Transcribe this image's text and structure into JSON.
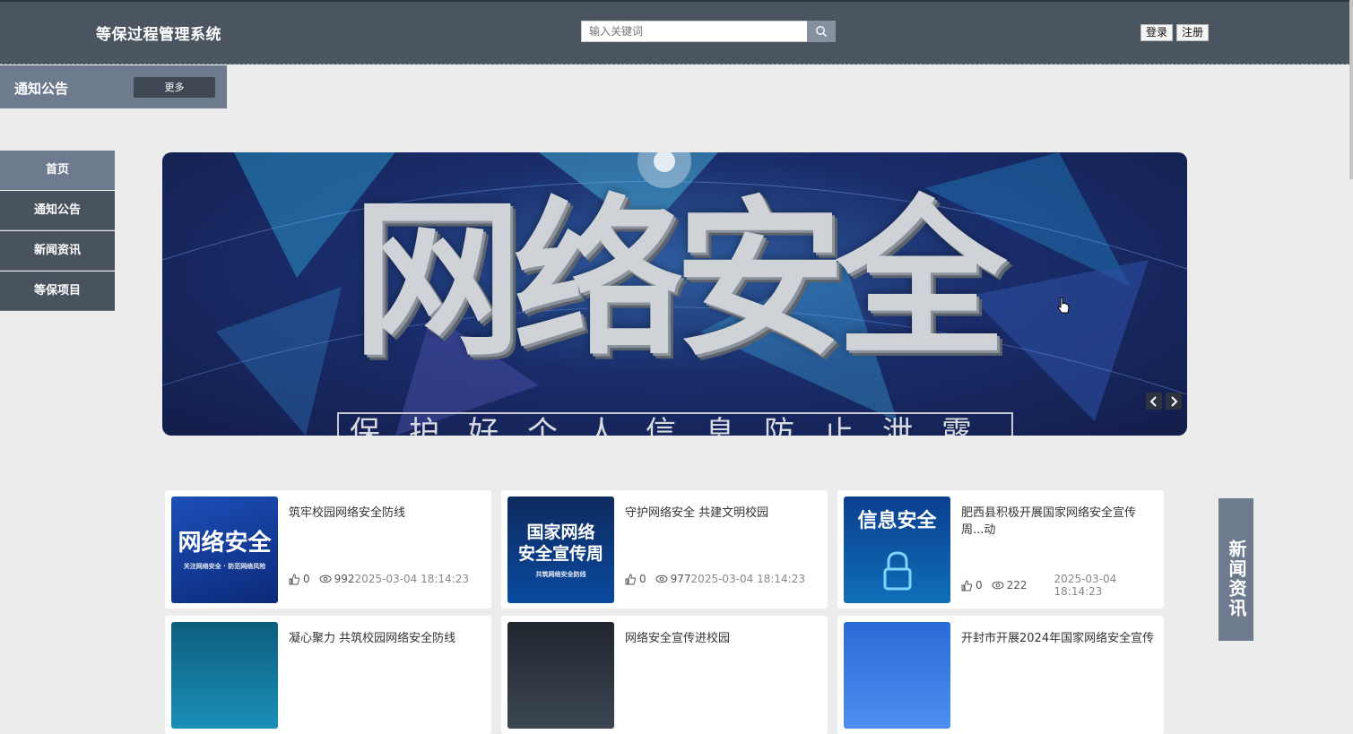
{
  "header": {
    "app_title": "等保过程管理系统",
    "search_placeholder": "输入关键词",
    "login_label": "登录",
    "register_label": "注册"
  },
  "notice": {
    "title": "通知公告",
    "more_label": "更多"
  },
  "sidenav": {
    "items": [
      {
        "label": "首页",
        "active": true
      },
      {
        "label": "通知公告",
        "active": false
      },
      {
        "label": "新闻资讯",
        "active": false
      },
      {
        "label": "等保项目",
        "active": false
      }
    ]
  },
  "banner": {
    "headline": "网络安全",
    "subline": "保护好个人信息防止泄露"
  },
  "news_tab": {
    "label": "新闻资讯"
  },
  "cards": [
    {
      "thumb_big": "网络安全",
      "thumb_small": "关注网络安全 · 防范网络风险",
      "title": "筑牢校园网络安全防线",
      "likes": "0",
      "views": "992",
      "date": "2025-03-04 18:14:23"
    },
    {
      "thumb_big": "国家网络\n安全宣传周",
      "thumb_small": "共筑网络安全防线",
      "title": "守护网络安全 共建文明校园",
      "likes": "0",
      "views": "977",
      "date": "2025-03-04 18:14:23"
    },
    {
      "thumb_big": "信息安全",
      "thumb_small": "",
      "title": "肥西县积极开展国家网络安全宣传周...动",
      "likes": "0",
      "views": "222",
      "date": "2025-03-04 18:14:23"
    },
    {
      "thumb_big": "",
      "thumb_small": "",
      "title": "凝心聚力 共筑校园网络安全防线",
      "likes": "",
      "views": "",
      "date": ""
    },
    {
      "thumb_big": "",
      "thumb_small": "",
      "title": "网络安全宣传进校园",
      "likes": "",
      "views": "",
      "date": ""
    },
    {
      "thumb_big": "",
      "thumb_small": "",
      "title": "开封市开展2024年国家网络安全宣传",
      "likes": "",
      "views": "",
      "date": ""
    }
  ],
  "colors": {
    "header_bg": "#4a5560",
    "accent": "#6e7b8f",
    "nav_bg": "#49535d"
  },
  "icons": [
    "search-icon",
    "like-icon",
    "eye-icon",
    "chevron-left-icon",
    "chevron-right-icon",
    "hand-cursor-icon"
  ]
}
